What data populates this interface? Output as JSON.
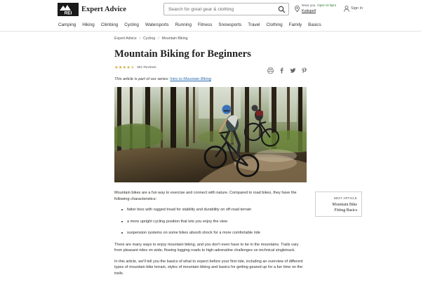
{
  "header": {
    "brand": "Expert Advice",
    "logo_text": "REI co-op",
    "search": {
      "placeholder": "Search for great gear & clothing",
      "icon": "search-icon"
    },
    "store": {
      "label": "Near you",
      "status": "Open til 9pm",
      "name": "Kalispell"
    },
    "signin": "Sign In"
  },
  "category_nav": [
    "Camping",
    "Hiking",
    "Climbing",
    "Cycling",
    "Watersports",
    "Running",
    "Fitness",
    "Snowsports",
    "Travel",
    "Clothing",
    "Family",
    "Basics"
  ],
  "breadcrumb": [
    "Expert Advice",
    "Cycling",
    "Mountain Biking"
  ],
  "article": {
    "title": "Mountain Biking for Beginners",
    "rating": 4.5,
    "reviews": "361 Reviews",
    "series_prefix": "This article is part of our series: ",
    "series_link": "Intro to Mountain Biking",
    "share_icons": [
      "print-icon",
      "facebook-icon",
      "twitter-icon",
      "pinterest-icon"
    ],
    "paragraphs": [
      "Mountain bikes are a fun way to exercise and connect with nature. Compared to road bikes, they have the following characteristics:",
      "There are many ways to enjoy mountain biking, and you don't even have to be in the mountains. Trails vary from pleasant rides on wide, flowing logging roads to high-adrenaline challenges on technical singletrack.",
      "In this article, we'll tell you the basics of what to expect before your first ride, including an overview of different types of mountain bike terrain, styles of mountain biking and basics for getting geared up for a fun time on the trails."
    ],
    "characteristics": [
      "fatter tires with rugged tread for stability and durability on off-road terrain",
      "a more upright cycling position that lets you enjoy the view",
      "suspension systems on some bikes absorb shock for a more comfortable ride"
    ]
  },
  "next_article": {
    "kicker": "NEXT ARTICLE",
    "title_line1": "Mountain Bike",
    "title_line2": "Fitting Basics"
  },
  "colors": {
    "link": "#2b6cb0",
    "star": "#d2b450",
    "open_status": "#2f7d32",
    "logo_bg": "#1a1a1a"
  }
}
